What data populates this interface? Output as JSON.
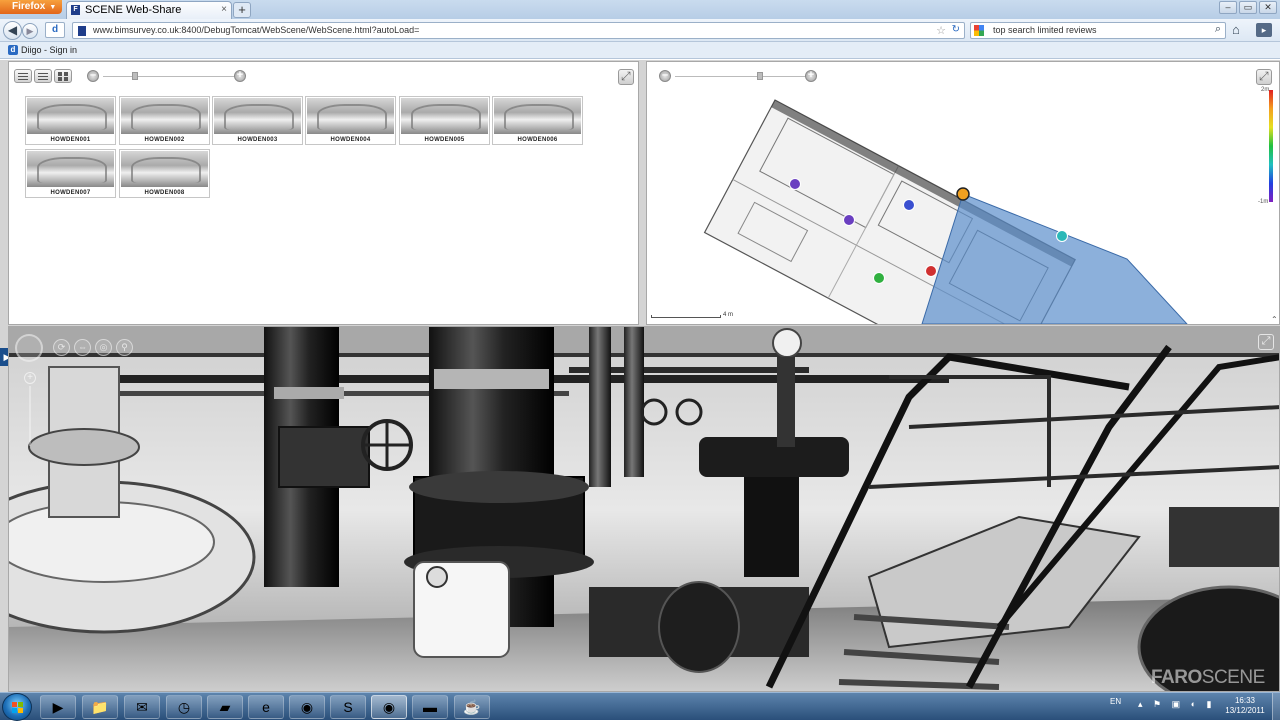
{
  "browser": {
    "menu_button": "Firefox",
    "tab_title": "SCENE Web-Share",
    "new_tab": "+",
    "url": "www.bimsurvey.co.uk:8400/DebugTomcat/WebScene/WebScene.html?autoLoad=",
    "search_text": "top search limited reviews",
    "bookmark": "Diigo - Sign in"
  },
  "thumbnails": {
    "items": [
      {
        "name": "HOWDEN001"
      },
      {
        "name": "HOWDEN002"
      },
      {
        "name": "HOWDEN003"
      },
      {
        "name": "HOWDEN004"
      },
      {
        "name": "HOWDEN005"
      },
      {
        "name": "HOWDEN006"
      },
      {
        "name": "HOWDEN007"
      },
      {
        "name": "HOWDEN008"
      }
    ]
  },
  "map": {
    "scale_top": "2m",
    "scale_bottom": "-1m",
    "scale_bar_label": "4 m",
    "scan_markers": [
      {
        "color": "#6a3fc0"
      },
      {
        "color": "#6a3fc0"
      },
      {
        "color": "#3a4fd0"
      },
      {
        "color": "#f0a020"
      },
      {
        "color": "#2ab8b8"
      },
      {
        "color": "#d03030"
      },
      {
        "color": "#30b040"
      }
    ],
    "fov_color": "#5b8fcc"
  },
  "scan_view": {
    "logo_bold": "FARO",
    "logo_light": "SCENE"
  },
  "taskbar": {
    "language": "EN",
    "time": "16:33",
    "date": "13/12/2011",
    "apps": [
      "windows-explorer",
      "outlook",
      "task-scheduler",
      "notepad",
      "internet-explorer",
      "firefox",
      "scene",
      "firefox-2",
      "cmd",
      "java"
    ]
  }
}
